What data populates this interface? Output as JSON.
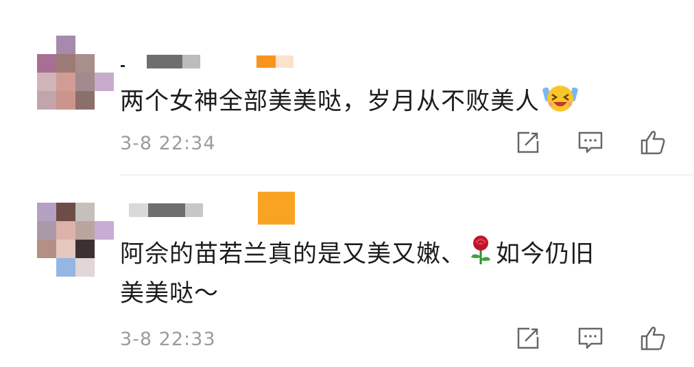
{
  "comments": [
    {
      "text": "两个女神全部美美哒，岁月从不败美人",
      "emoji": "laughing-crying-emoji",
      "time": "3-8 22:34",
      "avatar_colors": [
        [
          "#ffffff",
          "#a58aac",
          "#ffffff",
          "#ffffff"
        ],
        [
          "#a86e94",
          "#9c7a76",
          "#aa8e8c",
          "#ffffff"
        ],
        [
          "#cfb5ba",
          "#d09c95",
          "#a28a8e",
          "#c7abcd"
        ],
        [
          "#c3a4ab",
          "#cc958c",
          "#8c6e6a",
          "#ffffff"
        ]
      ]
    },
    {
      "text_line1": "阿佘的苗若兰真的是又美又嫩、",
      "text_line1_after": "如今仍旧",
      "text_line2": "美美哒～",
      "emoji": "rose-emoji",
      "time": "3-8 22:33",
      "avatar_colors": [
        [
          "#b59fc3",
          "#6e4d48",
          "#c5c0bb",
          "#ffffff"
        ],
        [
          "#ab98a9",
          "#ddb2aa",
          "#b9a59d",
          "#c9acd4"
        ],
        [
          "#b38f86",
          "#e7c7bd",
          "#3d3030",
          "#ffffff"
        ],
        [
          "#ffffff",
          "#93b6e2",
          "#e2d6d6",
          "#ffffff"
        ]
      ]
    }
  ],
  "icons": [
    "share-icon",
    "comment-icon",
    "like-icon"
  ]
}
